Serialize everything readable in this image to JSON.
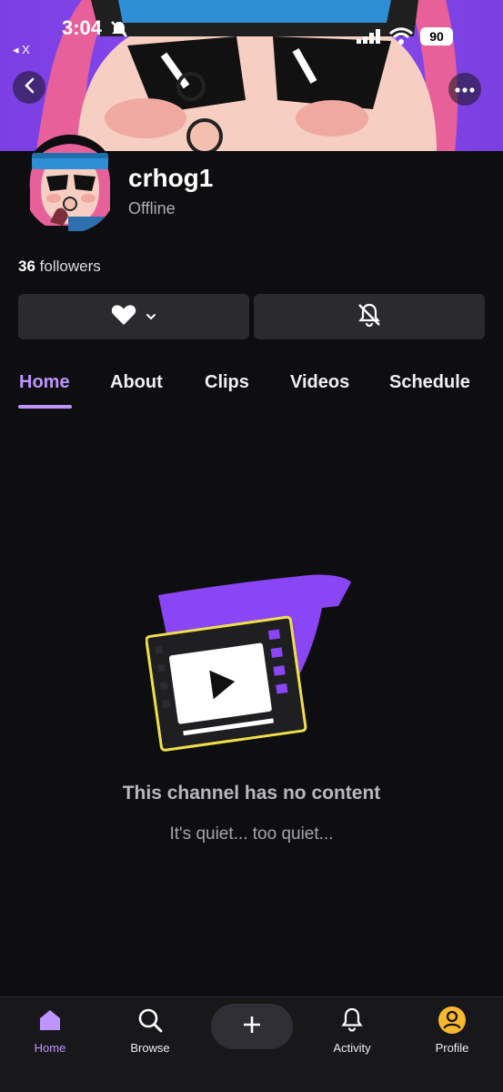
{
  "status_bar": {
    "time": "3:04",
    "back_app": "◂ X",
    "battery": "90"
  },
  "profile": {
    "username": "crhog1",
    "status": "Offline",
    "followers_count": "36",
    "followers_label": "followers"
  },
  "actions": {
    "follow_icon": "heart-icon",
    "notify_icon": "bell-off-icon"
  },
  "tabs": [
    {
      "label": "Home",
      "active": true
    },
    {
      "label": "About"
    },
    {
      "label": "Clips"
    },
    {
      "label": "Videos"
    },
    {
      "label": "Schedule"
    }
  ],
  "empty_state": {
    "title": "This channel has no content",
    "subtitle": "It's quiet... too quiet..."
  },
  "bottom_nav": [
    {
      "label": "Home",
      "icon": "home-icon",
      "active": true
    },
    {
      "label": "Browse",
      "icon": "search-icon"
    },
    {
      "label": "",
      "icon": "plus-icon"
    },
    {
      "label": "Activity",
      "icon": "bell-icon"
    },
    {
      "label": "Profile",
      "icon": "profile-icon"
    }
  ],
  "colors": {
    "accent": "#bf94ff",
    "background": "#0e0e10",
    "button": "#2a2a2f",
    "banner": "#8b4cf0"
  }
}
